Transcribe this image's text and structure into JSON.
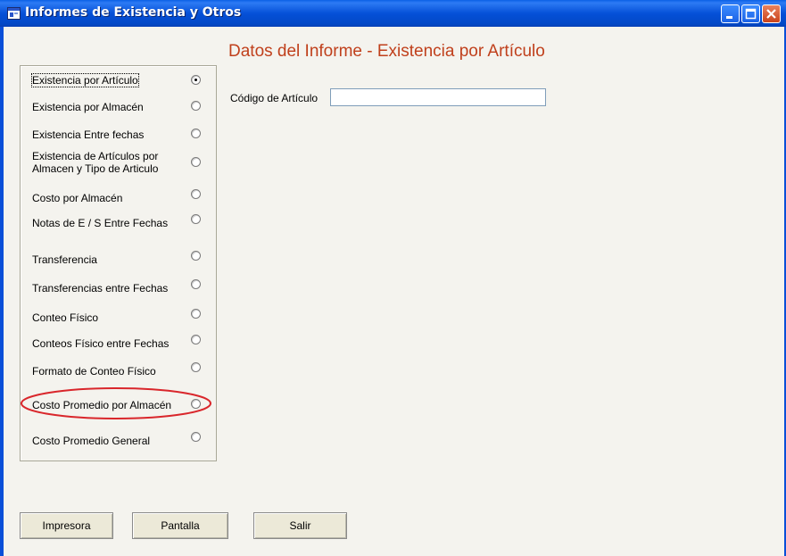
{
  "window": {
    "title": "Informes de Existencia y Otros"
  },
  "header": {
    "title": "Datos del Informe - Existencia por Artículo"
  },
  "report_options": [
    {
      "label": "Existencia por Artículo",
      "checked": true
    },
    {
      "label": "Existencia por Almacén",
      "checked": false
    },
    {
      "label": "Existencia Entre fechas",
      "checked": false
    },
    {
      "label": "Existencia de Artículos por Almacen y Tipo de Articulo",
      "checked": false
    },
    {
      "label": "Costo por Almacén",
      "checked": false
    },
    {
      "label": "Notas de E / S Entre Fechas",
      "checked": false
    },
    {
      "label": "Transferencia",
      "checked": false
    },
    {
      "label": "Transferencias entre Fechas",
      "checked": false
    },
    {
      "label": "Conteo Físico",
      "checked": false
    },
    {
      "label": "Conteos Físico entre Fechas",
      "checked": false
    },
    {
      "label": "Formato de Conteo Físico",
      "checked": false
    },
    {
      "label": "Costo Promedio  por Almacén",
      "checked": false
    },
    {
      "label": "Costo Promedio  General",
      "checked": false
    }
  ],
  "form": {
    "codigo_label": "Código de Artículo",
    "codigo_value": ""
  },
  "buttons": {
    "impresora": "Impresora",
    "pantalla": "Pantalla",
    "salir": "Salir"
  },
  "annotation": {
    "color": "#d9262b"
  }
}
